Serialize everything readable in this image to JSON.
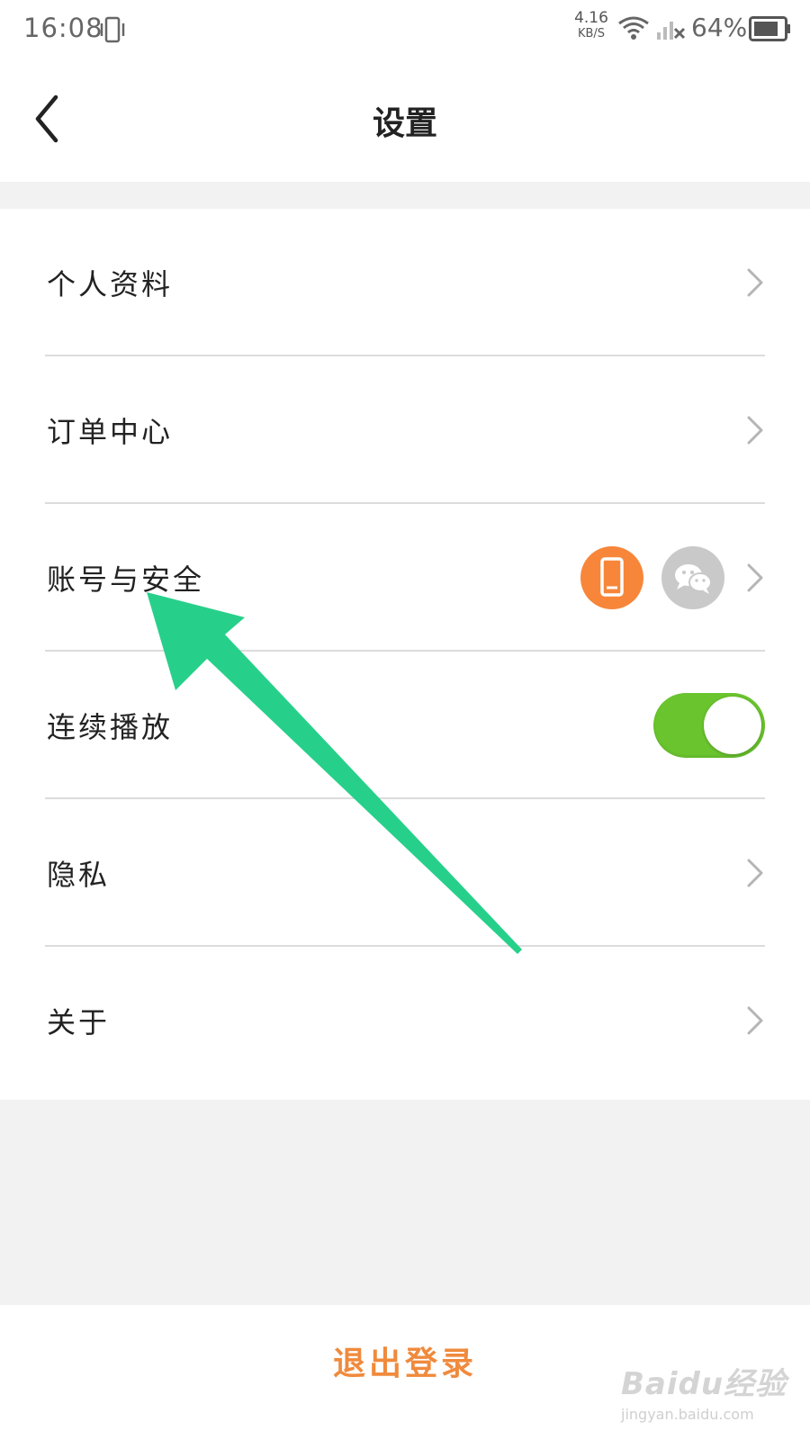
{
  "status_bar": {
    "time": "16:08",
    "net_speed_value": "4.16",
    "net_speed_unit": "KB/S",
    "battery_percent": "64%",
    "icons": [
      "vibrate-icon",
      "wifi-icon",
      "signal-icon",
      "battery-icon"
    ]
  },
  "header": {
    "title": "设置",
    "back_icon": "chevron-left-icon"
  },
  "menu": {
    "items": [
      {
        "label": "个人资料",
        "accessory": "chevron"
      },
      {
        "label": "订单中心",
        "accessory": "chevron"
      },
      {
        "label": "账号与安全",
        "accessory": "chevron",
        "badges": [
          "phone-icon",
          "wechat-icon"
        ]
      },
      {
        "label": "连续播放",
        "accessory": "toggle",
        "toggle_on": true
      },
      {
        "label": "隐私",
        "accessory": "chevron"
      },
      {
        "label": "关于",
        "accessory": "chevron"
      }
    ]
  },
  "logout_label": "退出登录",
  "watermark": {
    "brand": "Baidu经验",
    "url": "jingyan.baidu.com"
  },
  "colors": {
    "accent_orange": "#f08a3c",
    "toggle_green": "#6ac42e",
    "arrow_green": "#27d08a",
    "badge_gray": "#c9c9c9"
  }
}
